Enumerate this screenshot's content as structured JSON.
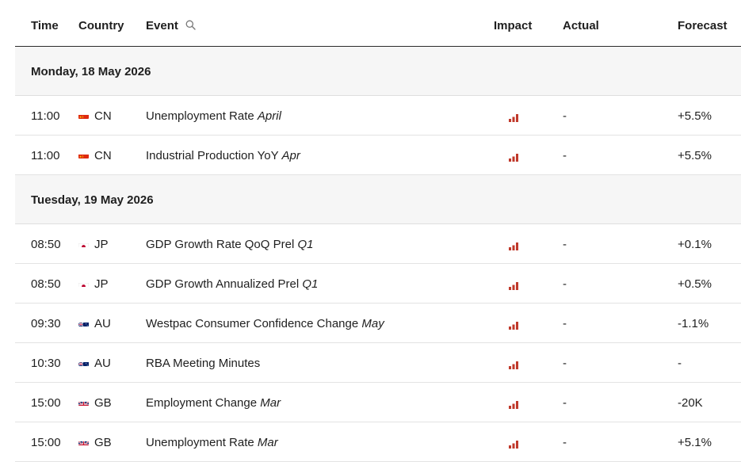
{
  "header": {
    "time": "Time",
    "country": "Country",
    "event": "Event",
    "impact": "Impact",
    "actual": "Actual",
    "forecast": "Forecast"
  },
  "days": [
    {
      "label": "Monday, 18 May 2026",
      "events": [
        {
          "time": "11:00",
          "flag": "cn",
          "country": "CN",
          "event": "Unemployment Rate",
          "period": "April",
          "actual": "-",
          "forecast": "+5.5%"
        },
        {
          "time": "11:00",
          "flag": "cn",
          "country": "CN",
          "event": "Industrial Production YoY",
          "period": "Apr",
          "actual": "-",
          "forecast": "+5.5%"
        }
      ]
    },
    {
      "label": "Tuesday, 19 May 2026",
      "events": [
        {
          "time": "08:50",
          "flag": "jp",
          "country": "JP",
          "event": "GDP Growth Rate QoQ Prel",
          "period": "Q1",
          "actual": "-",
          "forecast": "+0.1%"
        },
        {
          "time": "08:50",
          "flag": "jp",
          "country": "JP",
          "event": "GDP Growth Annualized Prel",
          "period": "Q1",
          "actual": "-",
          "forecast": "+0.5%"
        },
        {
          "time": "09:30",
          "flag": "au",
          "country": "AU",
          "event": "Westpac Consumer Confidence Change",
          "period": "May",
          "actual": "-",
          "forecast": "-1.1%"
        },
        {
          "time": "10:30",
          "flag": "au",
          "country": "AU",
          "event": "RBA Meeting Minutes",
          "period": "",
          "actual": "-",
          "forecast": "-"
        },
        {
          "time": "15:00",
          "flag": "gb",
          "country": "GB",
          "event": "Employment Change",
          "period": "Mar",
          "actual": "-",
          "forecast": "-20K"
        },
        {
          "time": "15:00",
          "flag": "gb",
          "country": "GB",
          "event": "Unemployment Rate",
          "period": "Mar",
          "actual": "-",
          "forecast": "+5.1%"
        }
      ]
    }
  ],
  "colors": {
    "impact_bar": "#c0392b",
    "day_bg": "#f6f6f6"
  },
  "icons": {
    "search": "search-icon",
    "impact": "impact-bars-icon"
  }
}
